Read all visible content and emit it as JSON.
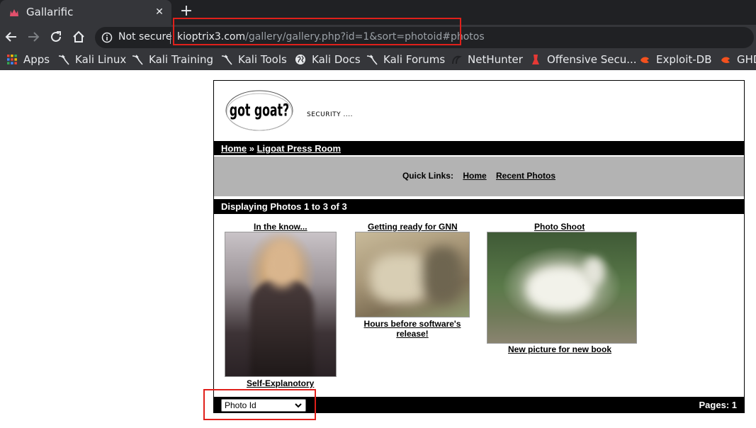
{
  "browser": {
    "tab_title": "Gallarific",
    "tab_close": "✕",
    "new_tab": "+",
    "not_secure": "Not secure",
    "url_host": "kioptrix3.com",
    "url_path": "/gallery/gallery.php?id=1&sort=photoid#photos",
    "bookmarks": [
      {
        "label": "Apps",
        "icon": "apps-grid-icon"
      },
      {
        "label": "Kali Linux",
        "icon": "kali-dragon-icon"
      },
      {
        "label": "Kali Training",
        "icon": "kali-dragon-icon"
      },
      {
        "label": "Kali Tools",
        "icon": "kali-dragon-icon"
      },
      {
        "label": "Kali Docs",
        "icon": "globe-icon"
      },
      {
        "label": "Kali Forums",
        "icon": "kali-dragon-icon"
      },
      {
        "label": "NetHunter",
        "icon": "nethunter-icon"
      },
      {
        "label": "Offensive Secu...",
        "icon": "offsec-icon"
      },
      {
        "label": "Exploit-DB",
        "icon": "exploitdb-icon"
      },
      {
        "label": "GHD",
        "icon": "exploitdb-icon"
      }
    ]
  },
  "page": {
    "logo_text": "got goat?",
    "tagline": "SECURITY ....",
    "breadcrumb": {
      "home": "Home",
      "separator": " » ",
      "current": "Ligoat Press Room"
    },
    "quick_links": {
      "label": "Quick Links:",
      "home": "Home",
      "recent": "Recent Photos"
    },
    "displaying": "Displaying Photos 1 to 3 of 3",
    "photos": [
      {
        "title": "In the know...",
        "caption": "Self-Explanotory"
      },
      {
        "title": "Getting ready for GNN",
        "caption": "Hours before software's release!"
      },
      {
        "title": "Photo Shoot",
        "caption": "New picture for new book"
      }
    ],
    "sort_select": {
      "selected": "Photo Id"
    },
    "pages": "Pages: 1"
  },
  "colors": {
    "annotation": "#e0201b",
    "bar": "#000000",
    "quicklinks_bg": "#b3b3b3"
  }
}
